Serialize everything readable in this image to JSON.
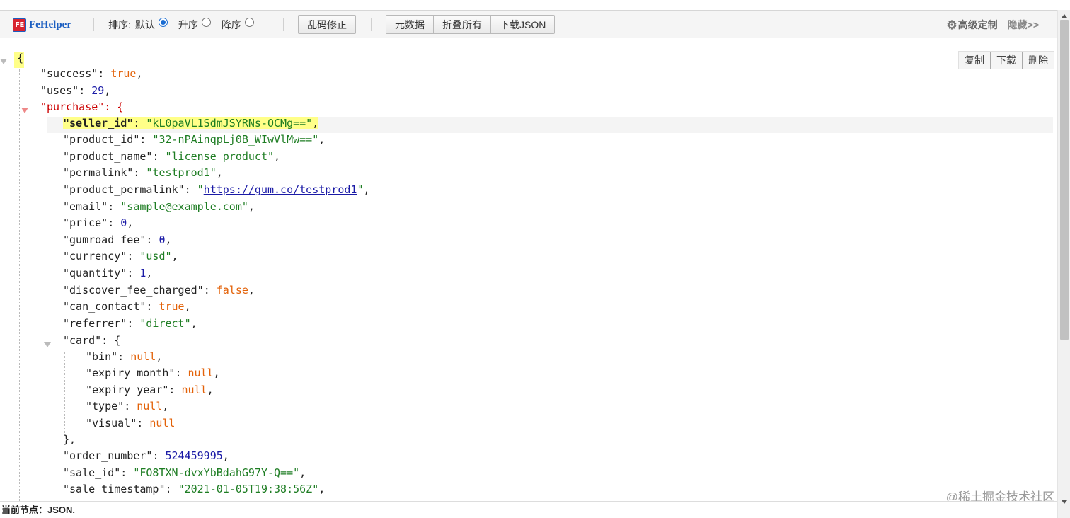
{
  "toolbar": {
    "brand_logo": "FE",
    "brand_name": "FeHelper",
    "sort_label": "排序:",
    "sort_options": [
      {
        "label": "默认",
        "checked": true
      },
      {
        "label": "升序",
        "checked": false
      },
      {
        "label": "降序",
        "checked": false
      }
    ],
    "fix_encoding_label": "乱码修正",
    "metadata_label": "元数据",
    "collapse_all_label": "折叠所有",
    "download_json_label": "下载JSON",
    "advanced_label": "高级定制",
    "hide_label": "隐藏>>",
    "advanced_icon": "gear-icon"
  },
  "actions": {
    "copy": "复制",
    "download": "下载",
    "delete": "删除"
  },
  "json_lines": [
    "{",
    "\"success\": true,",
    "\"uses\": 29,",
    "\"purchase\": {",
    "\"seller_id\": \"kL0paVL1SdmJSYRNs-OCMg==\",",
    "\"product_id\": \"32-nPAinqpLj0B_WIwVlMw==\",",
    "\"product_name\": \"license product\",",
    "\"permalink\": \"testprod1\",",
    "\"product_permalink\": \"https://gum.co/testprod1\",",
    "\"email\": \"sample@example.com\",",
    "\"price\": 0,",
    "\"gumroad_fee\": 0,",
    "\"currency\": \"usd\",",
    "\"quantity\": 1,",
    "\"discover_fee_charged\": false,",
    "\"can_contact\": true,",
    "\"referrer\": \"direct\",",
    "\"card\": {",
    "\"bin\": null,",
    "\"expiry_month\": null,",
    "\"expiry_year\": null,",
    "\"type\": null,",
    "\"visual\": null",
    "},",
    "\"order_number\": 524459995,",
    "\"sale_id\": \"FO8TXN-dvxYbBdahG97Y-Q==\",",
    "\"sale_timestamp\": \"2021-01-05T19:38:56Z\","
  ],
  "json": {
    "brace_open": "{",
    "success_key": "\"success\"",
    "success_val": "true",
    "uses_key": "\"uses\"",
    "uses_val": "29",
    "purchase_key": "\"purchase\"",
    "seller_id_key": "\"seller_id\"",
    "seller_id_val": "\"kL0paVL1SdmJSYRNs-OCMg==\"",
    "product_id_key": "\"product_id\"",
    "product_id_val": "\"32-nPAinqpLj0B_WIwVlMw==\"",
    "product_name_key": "\"product_name\"",
    "product_name_val": "\"license product\"",
    "permalink_key": "\"permalink\"",
    "permalink_val": "\"testprod1\"",
    "product_permalink_key": "\"product_permalink\"",
    "product_permalink_url": "https://gum.co/testprod1",
    "email_key": "\"email\"",
    "email_val": "\"sample@example.com\"",
    "price_key": "\"price\"",
    "price_val": "0",
    "gumroad_fee_key": "\"gumroad_fee\"",
    "gumroad_fee_val": "0",
    "currency_key": "\"currency\"",
    "currency_val": "\"usd\"",
    "quantity_key": "\"quantity\"",
    "quantity_val": "1",
    "discover_fee_charged_key": "\"discover_fee_charged\"",
    "discover_fee_charged_val": "false",
    "can_contact_key": "\"can_contact\"",
    "can_contact_val": "true",
    "referrer_key": "\"referrer\"",
    "referrer_val": "\"direct\"",
    "card_key": "\"card\"",
    "bin_key": "\"bin\"",
    "bin_val": "null",
    "expiry_month_key": "\"expiry_month\"",
    "expiry_month_val": "null",
    "expiry_year_key": "\"expiry_year\"",
    "expiry_year_val": "null",
    "type_key": "\"type\"",
    "type_val": "null",
    "visual_key": "\"visual\"",
    "visual_val": "null",
    "card_close": "},",
    "order_number_key": "\"order_number\"",
    "order_number_val": "524459995",
    "sale_id_key": "\"sale_id\"",
    "sale_id_val": "\"FO8TXN-dvxYbBdahG97Y-Q==\"",
    "sale_timestamp_key": "\"sale_timestamp\"",
    "sale_timestamp_val": "\"2021-01-05T19:38:56Z\""
  },
  "status": {
    "current_node": "当前节点：JSON."
  },
  "watermark": "@稀土掘金技术社区",
  "colors": {
    "string": "#1e7d23",
    "number": "#1a1aa6",
    "keyword": "#e36209",
    "highlight": "#ffff88",
    "brand_red": "#d9232f",
    "brand_blue": "#1b5ec1"
  }
}
